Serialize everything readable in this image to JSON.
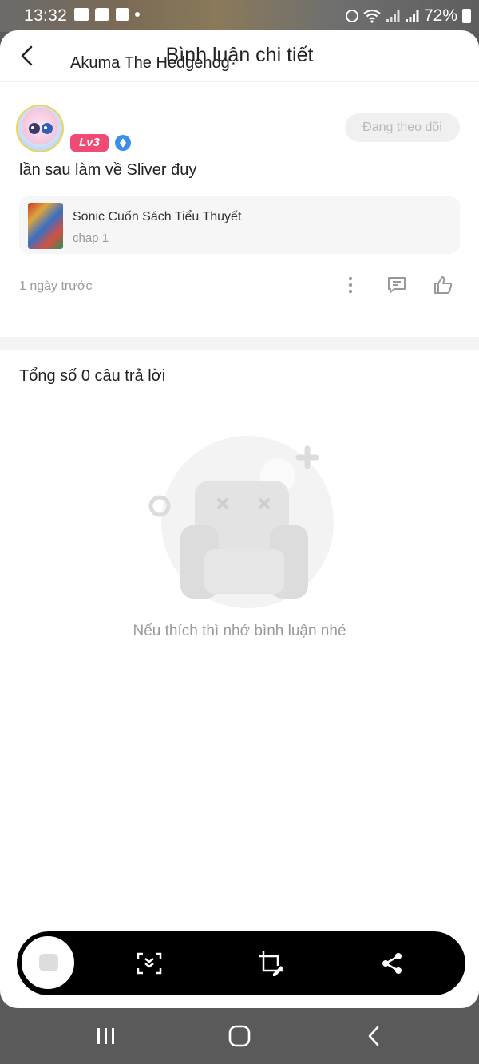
{
  "status_bar": {
    "time": "13:32",
    "battery": "72%",
    "icons": [
      "gallery-icon",
      "message-icon",
      "facebook-icon",
      "dot-icon",
      "alarm-icon",
      "wifi-icon",
      "signal-icon",
      "signal-icon"
    ]
  },
  "header": {
    "title": "Bình luận chi tiết",
    "back_icon": "chevron-left-icon"
  },
  "comment": {
    "username": "Akuma The Hedgehog",
    "level": "Lv3",
    "follow_label": "Đang theo dõi",
    "text": "lần sau làm về Sliver đuy",
    "book": {
      "title": "Sonic Cuốn Sách Tiểu Thuyết",
      "chapter": "chap 1"
    },
    "time_ago": "1 ngày trước",
    "actions": [
      "more-icon",
      "reply-icon",
      "like-icon"
    ]
  },
  "replies": {
    "total_label": "Tổng số 0 câu trả lời",
    "empty_message": "Nếu thích thì nhớ bình luận nhé"
  },
  "screenshot_toolbar": {
    "buttons": [
      "scroll-capture-icon",
      "crop-edit-icon",
      "share-icon"
    ]
  },
  "colors": {
    "level_badge": "#f04b74",
    "rank_badge": "#3d8ee8",
    "muted_text": "#9a9a9a"
  }
}
